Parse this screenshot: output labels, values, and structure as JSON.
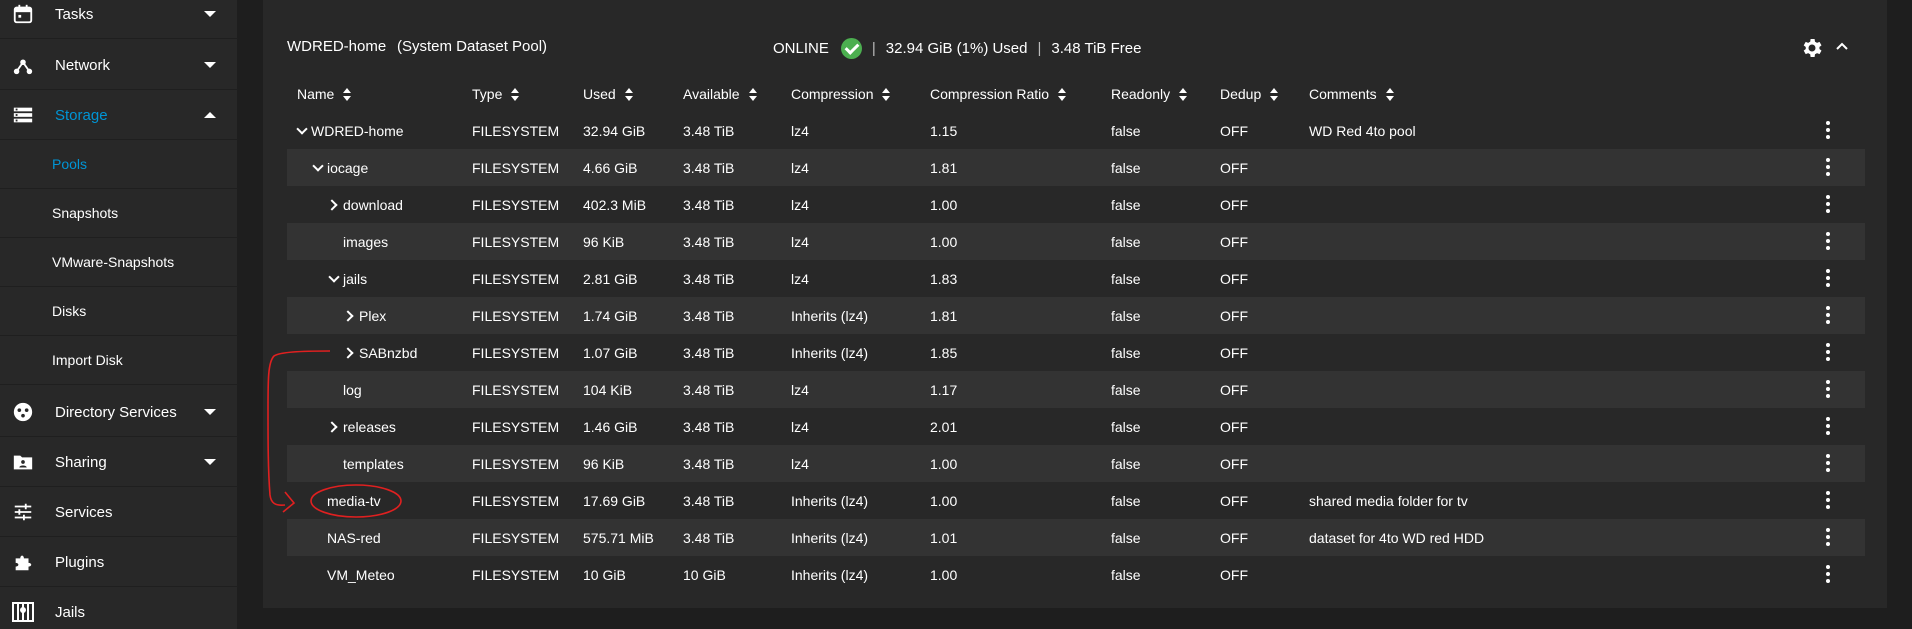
{
  "sidebar": {
    "items": [
      {
        "label": "Tasks",
        "icon": "calendar-icon",
        "caret": "down"
      },
      {
        "label": "Network",
        "icon": "network-icon",
        "caret": "down"
      },
      {
        "label": "Storage",
        "icon": "storage-icon",
        "caret": "up",
        "active": true
      },
      {
        "label": "Directory Services",
        "icon": "directory-services-icon",
        "caret": "down"
      },
      {
        "label": "Sharing",
        "icon": "folder-share-icon",
        "caret": "down"
      },
      {
        "label": "Services",
        "icon": "sliders-icon"
      },
      {
        "label": "Plugins",
        "icon": "puzzle-icon"
      },
      {
        "label": "Jails",
        "icon": "jail-icon"
      }
    ],
    "storage_sub": [
      {
        "label": "Pools",
        "active": true
      },
      {
        "label": "Snapshots"
      },
      {
        "label": "VMware-Snapshots"
      },
      {
        "label": "Disks"
      },
      {
        "label": "Import Disk"
      }
    ]
  },
  "pool": {
    "name": "WDRED-home",
    "type": "(System Dataset Pool)",
    "status": "ONLINE",
    "used": "32.94 GiB (1%) Used",
    "free": "3.48 TiB Free",
    "separator": "|"
  },
  "table": {
    "columns": [
      "Name",
      "Type",
      "Used",
      "Available",
      "Compression",
      "Compression Ratio",
      "Readonly",
      "Dedup",
      "Comments"
    ],
    "rows": [
      {
        "name": "WDRED-home",
        "toggle": "open",
        "type": "FILESYSTEM",
        "used": "32.94 GiB",
        "available": "3.48 TiB",
        "compression": "lz4",
        "ratio": "1.15",
        "readonly": "false",
        "dedup": "OFF",
        "comments": "WD Red 4to pool"
      },
      {
        "name": "iocage",
        "toggle": "open",
        "type": "FILESYSTEM",
        "used": "4.66 GiB",
        "available": "3.48 TiB",
        "compression": "lz4",
        "ratio": "1.81",
        "readonly": "false",
        "dedup": "OFF",
        "comments": ""
      },
      {
        "name": "download",
        "toggle": "closed",
        "type": "FILESYSTEM",
        "used": "402.3 MiB",
        "available": "3.48 TiB",
        "compression": "lz4",
        "ratio": "1.00",
        "readonly": "false",
        "dedup": "OFF",
        "comments": ""
      },
      {
        "name": "images",
        "toggle": "",
        "type": "FILESYSTEM",
        "used": "96 KiB",
        "available": "3.48 TiB",
        "compression": "lz4",
        "ratio": "1.00",
        "readonly": "false",
        "dedup": "OFF",
        "comments": ""
      },
      {
        "name": "jails",
        "toggle": "open",
        "type": "FILESYSTEM",
        "used": "2.81 GiB",
        "available": "3.48 TiB",
        "compression": "lz4",
        "ratio": "1.83",
        "readonly": "false",
        "dedup": "OFF",
        "comments": ""
      },
      {
        "name": "Plex",
        "toggle": "closed",
        "type": "FILESYSTEM",
        "used": "1.74 GiB",
        "available": "3.48 TiB",
        "compression": "Inherits (lz4)",
        "ratio": "1.81",
        "readonly": "false",
        "dedup": "OFF",
        "comments": ""
      },
      {
        "name": "SABnzbd",
        "toggle": "closed",
        "type": "FILESYSTEM",
        "used": "1.07 GiB",
        "available": "3.48 TiB",
        "compression": "Inherits (lz4)",
        "ratio": "1.85",
        "readonly": "false",
        "dedup": "OFF",
        "comments": ""
      },
      {
        "name": "log",
        "toggle": "",
        "type": "FILESYSTEM",
        "used": "104 KiB",
        "available": "3.48 TiB",
        "compression": "lz4",
        "ratio": "1.17",
        "readonly": "false",
        "dedup": "OFF",
        "comments": ""
      },
      {
        "name": "releases",
        "toggle": "closed",
        "type": "FILESYSTEM",
        "used": "1.46 GiB",
        "available": "3.48 TiB",
        "compression": "lz4",
        "ratio": "2.01",
        "readonly": "false",
        "dedup": "OFF",
        "comments": ""
      },
      {
        "name": "templates",
        "toggle": "",
        "type": "FILESYSTEM",
        "used": "96 KiB",
        "available": "3.48 TiB",
        "compression": "lz4",
        "ratio": "1.00",
        "readonly": "false",
        "dedup": "OFF",
        "comments": ""
      },
      {
        "name": "media-tv",
        "toggle": "",
        "type": "FILESYSTEM",
        "used": "17.69 GiB",
        "available": "3.48 TiB",
        "compression": "Inherits (lz4)",
        "ratio": "1.00",
        "readonly": "false",
        "dedup": "OFF",
        "comments": "shared media folder for tv"
      },
      {
        "name": "NAS-red",
        "toggle": "",
        "type": "FILESYSTEM",
        "used": "575.71 MiB",
        "available": "3.48 TiB",
        "compression": "Inherits (lz4)",
        "ratio": "1.01",
        "readonly": "false",
        "dedup": "OFF",
        "comments": "dataset for 4to WD red HDD"
      },
      {
        "name": "VM_Meteo",
        "toggle": "",
        "type": "FILESYSTEM",
        "used": "10 GiB",
        "available": "10 GiB",
        "compression": "Inherits (lz4)",
        "ratio": "1.00",
        "readonly": "false",
        "dedup": "OFF",
        "comments": ""
      }
    ]
  },
  "colors": {
    "accent": "#0095d5",
    "online": "#4caf50",
    "annotation": "#e02020"
  }
}
